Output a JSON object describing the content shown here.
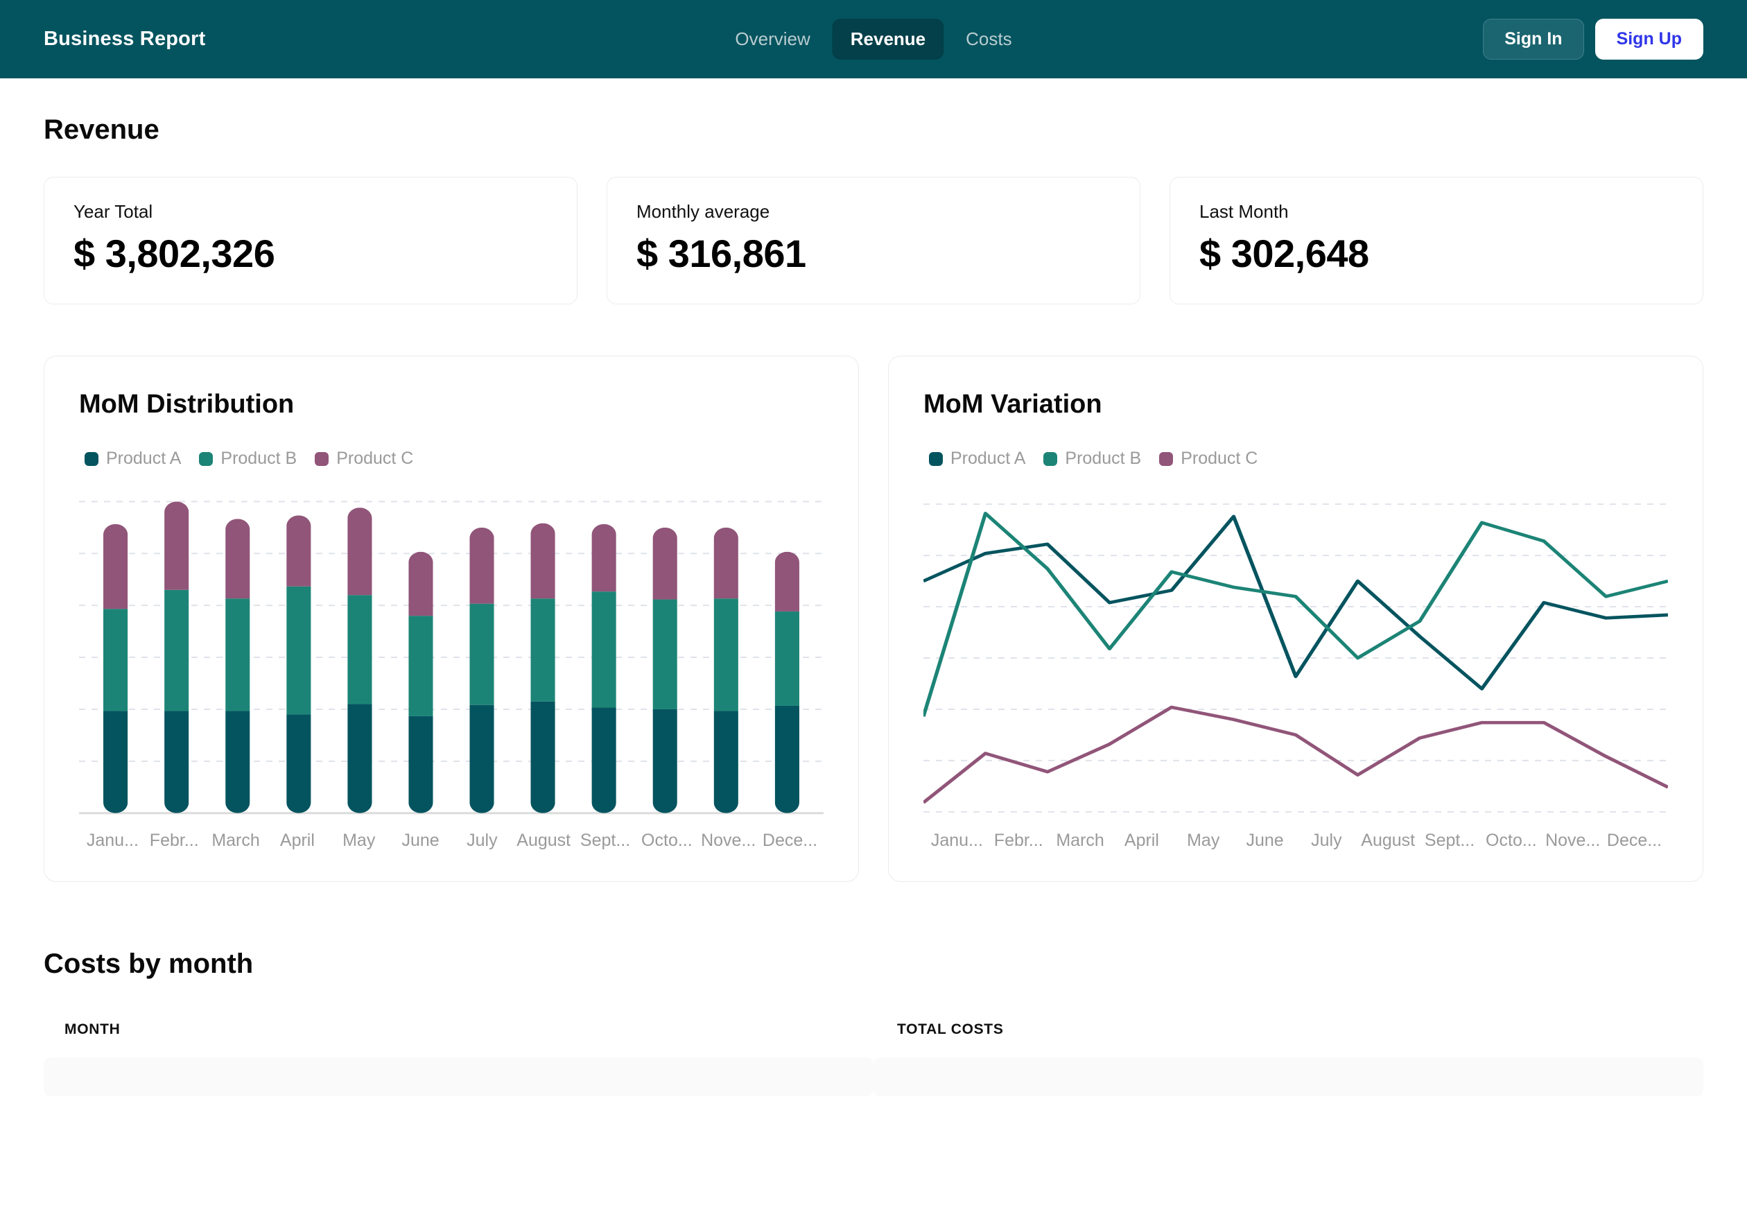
{
  "header": {
    "brand": "Business Report",
    "tabs": [
      {
        "label": "Overview",
        "active": false
      },
      {
        "label": "Revenue",
        "active": true
      },
      {
        "label": "Costs",
        "active": false
      }
    ],
    "sign_in_label": "Sign In",
    "sign_up_label": "Sign Up",
    "bg_color": "#04545f",
    "active_tab_bg": "#034049",
    "sign_up_text_color": "#2f35e8"
  },
  "page": {
    "title": "Revenue",
    "costs_section_title": "Costs by month"
  },
  "kpis": [
    {
      "label": "Year Total",
      "value": "$ 3,802,326"
    },
    {
      "label": "Monthly average",
      "value": "$ 316,861"
    },
    {
      "label": "Last Month",
      "value": "$ 302,648"
    }
  ],
  "colors": {
    "product_a": "#04545f",
    "product_b": "#1c8476",
    "product_c": "#915579",
    "gridline": "#dfe2ea",
    "axis": "#dcdcdc"
  },
  "costs_table": {
    "columns": [
      "MONTH",
      "TOTAL COSTS"
    ],
    "rows": [
      {
        "month": "",
        "total": ""
      }
    ]
  },
  "chart_data": [
    {
      "type": "bar",
      "title": "MoM Distribution",
      "stacked": true,
      "xlabel": "",
      "ylabel": "",
      "grid": true,
      "legend_position": "top-left",
      "categories": [
        "Janu...",
        "Febr...",
        "March",
        "April",
        "May",
        "June",
        "July",
        "August",
        "Sept...",
        "Octo...",
        "Nove...",
        "Dece..."
      ],
      "categories_full": [
        "January",
        "February",
        "March",
        "April",
        "May",
        "June",
        "July",
        "August",
        "September",
        "October",
        "November",
        "December"
      ],
      "ylim": [
        0,
        360
      ],
      "series": [
        {
          "name": "Product A",
          "color": "#04545f",
          "values": [
            118,
            118,
            118,
            114,
            126,
            112,
            125,
            129,
            122,
            120,
            118,
            124
          ]
        },
        {
          "name": "Product B",
          "color": "#1c8476",
          "values": [
            118,
            140,
            130,
            148,
            126,
            116,
            117,
            119,
            134,
            127,
            130,
            109
          ]
        },
        {
          "name": "Product C",
          "color": "#915579",
          "values": [
            98,
            102,
            92,
            82,
            101,
            74,
            88,
            87,
            78,
            83,
            82,
            69
          ]
        }
      ]
    },
    {
      "type": "line",
      "title": "MoM Variation",
      "xlabel": "",
      "ylabel": "",
      "grid": true,
      "legend_position": "top-left",
      "categories": [
        "Janu...",
        "Febr...",
        "March",
        "April",
        "May",
        "June",
        "July",
        "August",
        "Sept...",
        "Octo...",
        "Nove...",
        "Dece..."
      ],
      "categories_full": [
        "January",
        "February",
        "March",
        "April",
        "May",
        "June",
        "July",
        "August",
        "September",
        "October",
        "November",
        "December"
      ],
      "ylim": [
        0,
        100
      ],
      "series": [
        {
          "name": "Product A",
          "color": "#04545f",
          "values": [
            75,
            84,
            87,
            68,
            72,
            96,
            44,
            75,
            57,
            40,
            68,
            63,
            64
          ]
        },
        {
          "name": "Product B",
          "color": "#1c8476",
          "values": [
            31,
            97,
            79,
            53,
            78,
            73,
            70,
            50,
            62,
            94,
            88,
            70,
            75
          ]
        },
        {
          "name": "Product C",
          "color": "#915579",
          "values": [
            3,
            19,
            13,
            22,
            34,
            30,
            25,
            12,
            24,
            29,
            29,
            18,
            8
          ]
        }
      ]
    }
  ]
}
